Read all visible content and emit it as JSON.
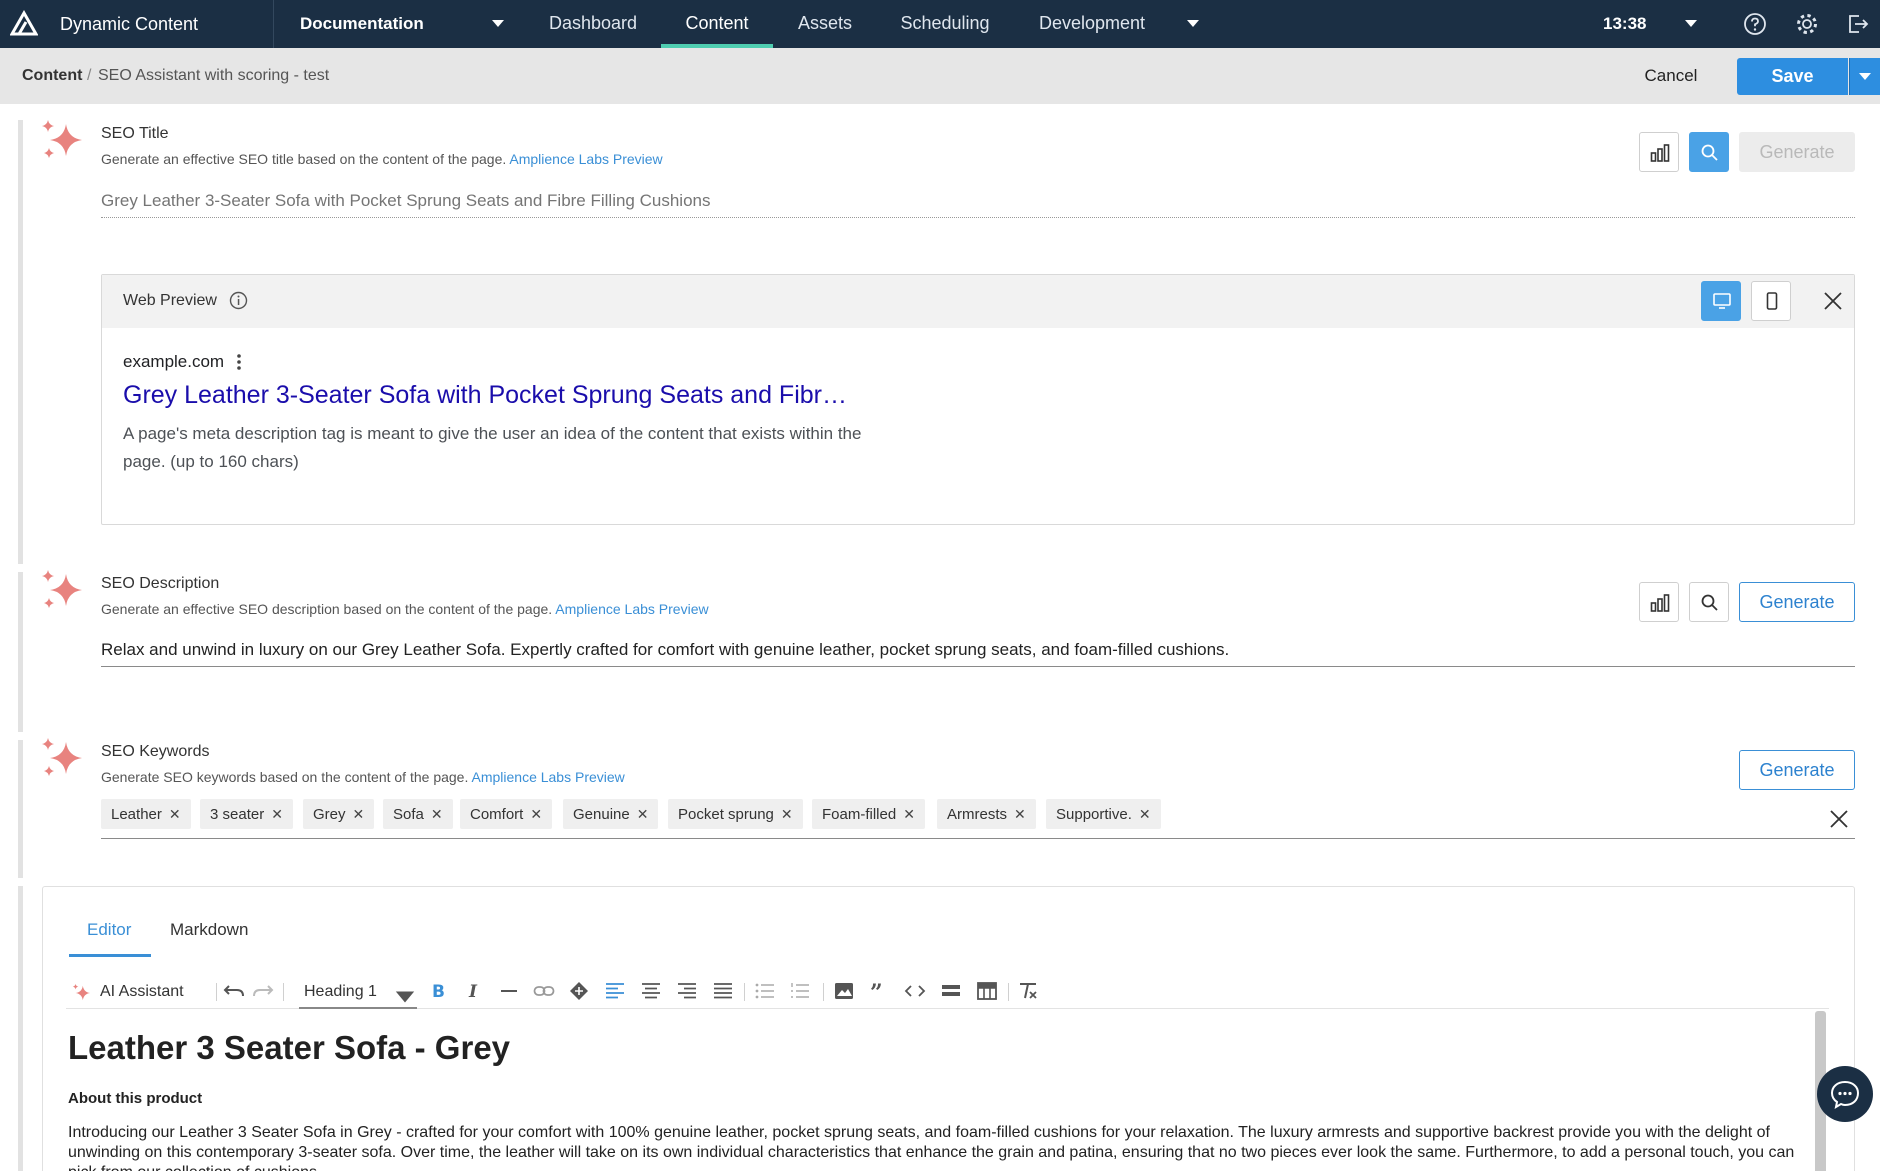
{
  "app": {
    "name": "Dynamic Content",
    "hub": "Documentation",
    "tabs": [
      "Dashboard",
      "Content",
      "Assets",
      "Scheduling",
      "Development"
    ],
    "active_tab": "Content",
    "clock": "13:38"
  },
  "breadcrumb": {
    "root": "Content",
    "separator": "/",
    "current": "SEO Assistant with scoring - test"
  },
  "actions": {
    "cancel": "Cancel",
    "save": "Save"
  },
  "seo_title": {
    "label": "SEO Title",
    "description": "Generate an effective SEO title based on the content of the page.",
    "labs_link": "Amplience Labs Preview",
    "placeholder": "Grey Leather 3-Seater Sofa with Pocket Sprung Seats and Fibre Filling Cushions",
    "generate": "Generate"
  },
  "web_preview": {
    "title": "Web Preview",
    "site": "example.com",
    "result_title": "Grey Leather 3-Seater Sofa with Pocket Sprung Seats and Fibr…",
    "result_desc": "A page's meta description tag is meant to give the user an idea of the content that exists within the page. (up to 160 chars)"
  },
  "seo_description": {
    "label": "SEO Description",
    "description": "Generate an effective SEO description based on the content of the page.",
    "labs_link": "Amplience Labs Preview",
    "value": "Relax and unwind in luxury on our Grey Leather Sofa. Expertly crafted for comfort with genuine leather, pocket sprung seats, and foam-filled cushions.",
    "generate": "Generate"
  },
  "seo_keywords": {
    "label": "SEO Keywords",
    "description": "Generate SEO keywords based on the content of the page.",
    "labs_link": "Amplience Labs Preview",
    "generate": "Generate",
    "chips": [
      "Leather",
      "3 seater",
      "Grey",
      "Sofa",
      "Comfort",
      "Genuine",
      "Pocket sprung",
      "Foam-filled",
      "Armrests",
      "Supportive."
    ]
  },
  "editor": {
    "tabs": [
      "Editor",
      "Markdown"
    ],
    "ai_assistant": "AI Assistant",
    "heading_select": "Heading 1",
    "h1": "Leather 3 Seater Sofa - Grey",
    "h3": "About this product",
    "paragraph": "Introducing our Leather 3 Seater Sofa in Grey - crafted for your comfort with 100% genuine leather, pocket sprung seats, and foam-filled cushions for your relaxation. The luxury armrests and supportive backrest provide you with the delight of unwinding on this contemporary 3-seater sofa. Over time, the leather will take on its own individual characteristics that enhance the grain and patina, ensuring that no two pieces ever look the same. Furthermore, to add a personal touch, you can pick from our collection of cushions."
  },
  "colors": {
    "nav_bg": "#1b2f44",
    "accent": "#2d8ee0",
    "active_tab_underline": "#4ecdb0",
    "sparkle": "#e8837f"
  }
}
